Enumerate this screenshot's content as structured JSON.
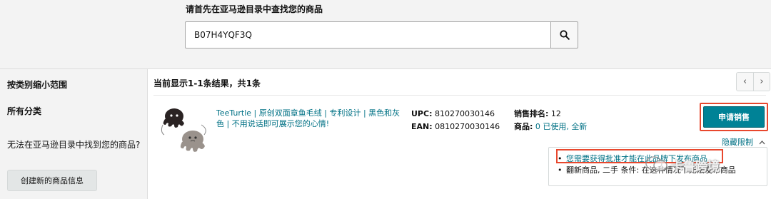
{
  "search": {
    "prompt": "请首先在亚马逊目录中查找您的商品",
    "value": "B07H4YQF3Q",
    "button_icon": "search-icon"
  },
  "sidebar": {
    "narrow_title": "按类别缩小范围",
    "all_categories": "所有分类",
    "not_found_text": "无法在亚马逊目录中找到您的商品?",
    "create_button": "创建新的商品信息"
  },
  "results": {
    "summary": "当前显示1-1条结果，共1条",
    "pager": {
      "prev": "‹",
      "next": "›"
    },
    "items": [
      {
        "title": "TeeTurtle | 原创双面章鱼毛绒 | 专利设计 | 黑色和灰色 | 不用说话即可展示您的心情!",
        "upc_label": "UPC:",
        "upc": "810270030146",
        "ean_label": "EAN:",
        "ean": "0810270030146",
        "rank_label": "销售排名:",
        "rank": "12",
        "offers_label": "商品:",
        "offers_count": "0",
        "offers_text": "已使用, 全新",
        "apply_button": "申请销售",
        "hide_limits": "隐藏限制",
        "restrictions": [
          "您需要获得批准才能在此品牌下发布商品",
          "翻新商品, 二手 条件: 在这种情况下无法发布商品"
        ]
      }
    ]
  },
  "watermark": "卡鲁跨境",
  "colors": {
    "accent": "#008296",
    "link": "#007185",
    "highlight": "#e8472d"
  }
}
